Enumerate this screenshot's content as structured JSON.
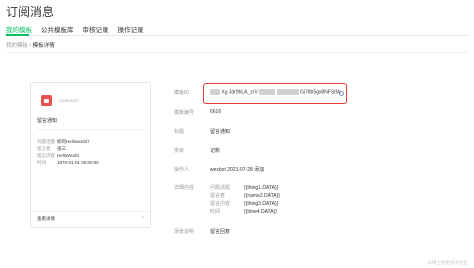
{
  "page": {
    "title": "订阅消息"
  },
  "tabs": [
    {
      "label": "我的模板",
      "active": true
    },
    {
      "label": "公共模板库",
      "active": false
    },
    {
      "label": "审核记录",
      "active": false
    },
    {
      "label": "操作记录",
      "active": false
    }
  ],
  "breadcrumb": {
    "parent": "我的模板",
    "separator": " / ",
    "current": "模板详情"
  },
  "preview": {
    "brand": "Liveboard",
    "title": "留言通知",
    "fields": [
      {
        "key": "问题话题",
        "value": "如何Helloworld?"
      },
      {
        "key": "留言者",
        "value": "张三"
      },
      {
        "key": "留言内容",
        "value": "HelloWorld"
      },
      {
        "key": "时间",
        "value": "1970-01-01 00:00:00"
      }
    ],
    "footer": "查看详情",
    "arrow": "›"
  },
  "details": {
    "template_id": {
      "label": "模板ID",
      "value_start": "Xg Jdr9hLA_zrV",
      "value_end": "Gi78b5gx8NFSIfA"
    },
    "template_code": {
      "label": "模板编号",
      "value": "6616"
    },
    "title": {
      "label": "标题",
      "value": "留言通知"
    },
    "category": {
      "label": "类目",
      "value": "记账"
    },
    "operator": {
      "label": "操作人",
      "value": "wexbot 2021-07-28 添加"
    },
    "content": {
      "label": "详细内容",
      "rows": [
        {
          "key": "问题话题",
          "value": "{{thing1.DATA}}"
        },
        {
          "key": "留言者",
          "value": "{{name2.DATA}}"
        },
        {
          "key": "留言内容",
          "value": "{{thing3.DATA}}"
        },
        {
          "key": "时间",
          "value": "{{time4.DATA}}"
        }
      ]
    },
    "scene": {
      "label": "场景说明",
      "value": "留言回复"
    }
  },
  "colors": {
    "accent": "#07c160",
    "highlight": "#e53935",
    "logo": "#e9514c"
  },
  "watermark": "@稀土掘金技术社区"
}
